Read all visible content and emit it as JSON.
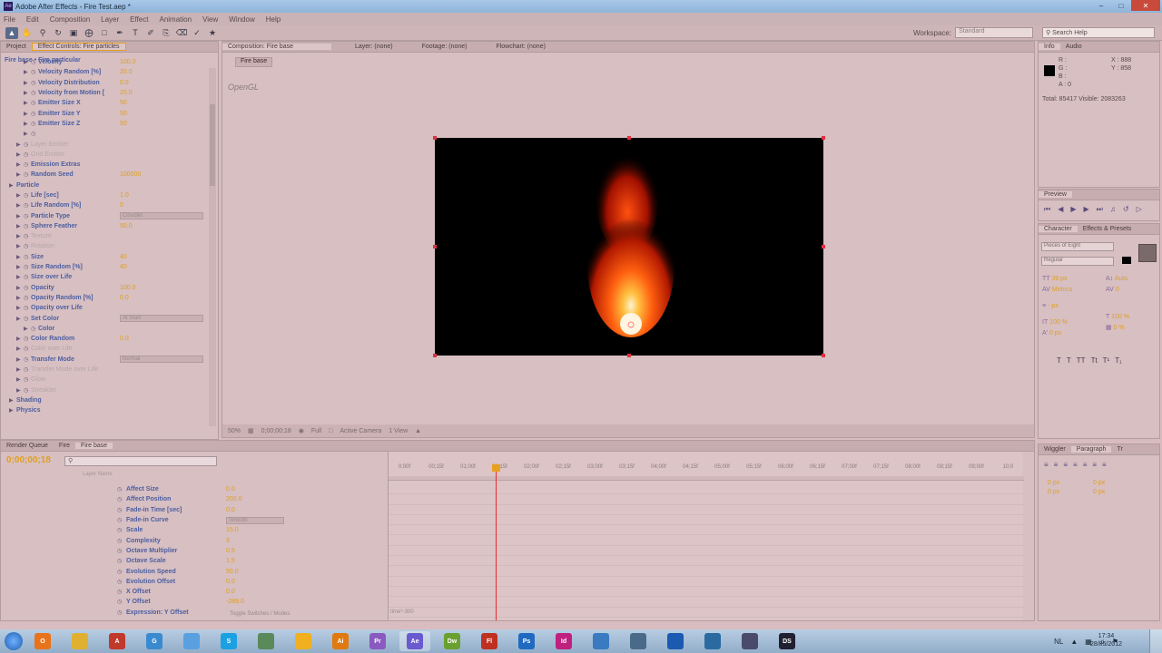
{
  "app": {
    "title": "Adobe After Effects - Fire Test.aep *"
  },
  "menu": [
    "File",
    "Edit",
    "Composition",
    "Layer",
    "Effect",
    "Animation",
    "View",
    "Window",
    "Help"
  ],
  "toolbar": {
    "workspace_label": "Workspace:",
    "workspace_value": "Standard",
    "search_placeholder": "Search Help"
  },
  "project_panel": {
    "tabs": [
      "Project",
      "Effect Controls: Fire particles"
    ],
    "breadcrumb": "Fire base • Fire particular",
    "rows": [
      {
        "name": "Velocity",
        "value": "100.0",
        "indent": 3
      },
      {
        "name": "Velocity Random [%]",
        "value": "20.0",
        "indent": 3
      },
      {
        "name": "Velocity Distribution",
        "value": "0.5",
        "indent": 3
      },
      {
        "name": "Velocity from Motion [",
        "value": "20.0",
        "indent": 3
      },
      {
        "name": "Emitter Size X",
        "value": "50",
        "indent": 3
      },
      {
        "name": "Emitter Size Y",
        "value": "50",
        "indent": 3
      },
      {
        "name": "Emitter Size Z",
        "value": "50",
        "indent": 3
      },
      {
        "name": "",
        "value": "",
        "indent": 3
      },
      {
        "name": "Layer Emitter",
        "value": "",
        "indent": 2,
        "faint": true
      },
      {
        "name": "Grid Emitter",
        "value": "",
        "indent": 2,
        "faint": true
      },
      {
        "name": "Emission Extras",
        "value": "",
        "indent": 2
      },
      {
        "name": "Random Seed",
        "value": "100000",
        "indent": 2
      },
      {
        "name": "Particle",
        "value": "",
        "indent": 1
      },
      {
        "name": "Life [sec]",
        "value": "1.0",
        "indent": 2
      },
      {
        "name": "Life Random [%]",
        "value": "0",
        "indent": 2
      },
      {
        "name": "Particle Type",
        "value": "Cloudlet",
        "indent": 2,
        "dropdown": true
      },
      {
        "name": "Sphere Feather",
        "value": "50.0",
        "indent": 2
      },
      {
        "name": "Texture",
        "value": "",
        "indent": 2,
        "faint": true
      },
      {
        "name": "Rotation",
        "value": "",
        "indent": 2,
        "faint": true
      },
      {
        "name": "Size",
        "value": "40",
        "indent": 2
      },
      {
        "name": "Size Random [%]",
        "value": "40",
        "indent": 2
      },
      {
        "name": "Size over Life",
        "value": "",
        "indent": 2
      },
      {
        "name": "Opacity",
        "value": "100.0",
        "indent": 2
      },
      {
        "name": "Opacity Random [%]",
        "value": "0.0",
        "indent": 2
      },
      {
        "name": "Opacity over Life",
        "value": "",
        "indent": 2
      },
      {
        "name": "Set Color",
        "value": "At Start",
        "indent": 2,
        "dropdown": true
      },
      {
        "name": "Color",
        "value": "",
        "indent": 3
      },
      {
        "name": "Color Random",
        "value": "0.0",
        "indent": 2
      },
      {
        "name": "Color over Life",
        "value": "",
        "indent": 2,
        "faint": true
      },
      {
        "name": "Transfer Mode",
        "value": "Normal",
        "indent": 2,
        "dropdown": true
      },
      {
        "name": "Transfer Mode over Life",
        "value": "",
        "indent": 2,
        "faint": true
      },
      {
        "name": "Glow",
        "value": "",
        "indent": 2,
        "faint": true
      },
      {
        "name": "Streaklet",
        "value": "",
        "indent": 2,
        "faint": true
      },
      {
        "name": "Shading",
        "value": "",
        "indent": 1
      },
      {
        "name": "Physics",
        "value": "",
        "indent": 1
      }
    ]
  },
  "composition": {
    "tabs": [
      "Composition: Fire base",
      "Layer: (none)",
      "Footage: (none)",
      "Flowchart: (none)"
    ],
    "crumb": "Fire base",
    "renderer": "OpenGL",
    "bottom": [
      "50%",
      "0;00;00;18",
      "Full",
      "Active Camera",
      "1 View"
    ]
  },
  "info_panel": {
    "tabs": [
      "Info",
      "Audio"
    ],
    "channels": [
      "R :",
      "G :",
      "B :",
      "A : 0"
    ],
    "coords": [
      "X : 888",
      "Y : 858"
    ],
    "totals": "Total: 85417  Visible: 2083263"
  },
  "preview_panel": {
    "tabs": [
      "Preview"
    ]
  },
  "character_panel": {
    "tabs": [
      "Character",
      "Effects & Presets"
    ],
    "font": "Pieces of Eight",
    "style": "Regular",
    "size_px": "39 px",
    "leading": "Auto",
    "tracking": "Metrics",
    "tracking_val": "0",
    "scale_v": "100 %",
    "scale_h": "100 %",
    "baseline": "0 px",
    "tsume": "0 %",
    "stroke_unit": "- px"
  },
  "wiggler_panel": {
    "tabs": [
      "Wiggler",
      "Paragraph",
      "Tr"
    ],
    "indent_left": "0 px",
    "indent_right": "0 px",
    "space_before": "0 px",
    "space_after": "0 px"
  },
  "timeline": {
    "tabs": [
      "Render Queue",
      "Fire",
      "Fire base"
    ],
    "timecode": "0;00;00;18",
    "search_placeholder": "",
    "columns": "Layer Name",
    "ruler": [
      "0;00f",
      "00;15f",
      "01;00f",
      "01;15f",
      "02;00f",
      "02;15f",
      "03;00f",
      "03;15f",
      "04;00f",
      "04;15f",
      "05;00f",
      "05;15f",
      "06;00f",
      "06;15f",
      "07;00f",
      "07;15f",
      "08;00f",
      "08;15f",
      "09;00f",
      "10;0"
    ],
    "rows": [
      {
        "name": "Affect Size",
        "value": "0.0"
      },
      {
        "name": "Affect Position",
        "value": "200.0"
      },
      {
        "name": "Fade-in Time [sec]",
        "value": "0.0"
      },
      {
        "name": "Fade-in Curve",
        "value": "Smooth",
        "dropdown": true
      },
      {
        "name": "Scale",
        "value": "15.0"
      },
      {
        "name": "Complexity",
        "value": "3"
      },
      {
        "name": "Octave Multiplier",
        "value": "0.5"
      },
      {
        "name": "Octave Scale",
        "value": "1.5"
      },
      {
        "name": "Evolution Speed",
        "value": "50.0"
      },
      {
        "name": "Evolution Offset",
        "value": "0.0"
      },
      {
        "name": "X Offset",
        "value": "0.0"
      },
      {
        "name": "Y Offset",
        "value": "-289.0"
      },
      {
        "name": "Expression: Y Offset",
        "value": ""
      }
    ],
    "footer": "Toggle Switches / Modes",
    "expr_label": "time*-300"
  },
  "taskbar": {
    "apps": [
      {
        "label": "O",
        "color": "#e8731a"
      },
      {
        "label": "",
        "color": "#e0b030"
      },
      {
        "label": "A",
        "color": "#c0392b"
      },
      {
        "label": "G",
        "color": "#3a8ad0"
      },
      {
        "label": "",
        "color": "#5aa0e0"
      },
      {
        "label": "S",
        "color": "#1ba1e2"
      },
      {
        "label": "",
        "color": "#5a8a5a"
      },
      {
        "label": "",
        "color": "#f0b020"
      },
      {
        "label": "Ai",
        "color": "#e07a10"
      },
      {
        "label": "Pr",
        "color": "#8a5ac0"
      },
      {
        "label": "Ae",
        "color": "#6a5ad0"
      },
      {
        "label": "Dw",
        "color": "#6aa030"
      },
      {
        "label": "Fl",
        "color": "#c03020"
      },
      {
        "label": "Ps",
        "color": "#1f6ac0"
      },
      {
        "label": "Id",
        "color": "#c02080"
      },
      {
        "label": "",
        "color": "#3a7ac0"
      },
      {
        "label": "",
        "color": "#4a6a8a"
      },
      {
        "label": "",
        "color": "#1a5ab0"
      },
      {
        "label": "",
        "color": "#2a6aa0"
      },
      {
        "label": "",
        "color": "#4a4a6a"
      },
      {
        "label": "DS",
        "color": "#202030"
      }
    ],
    "lang": "NL",
    "time": "17:34",
    "date": "28/05/2012"
  }
}
